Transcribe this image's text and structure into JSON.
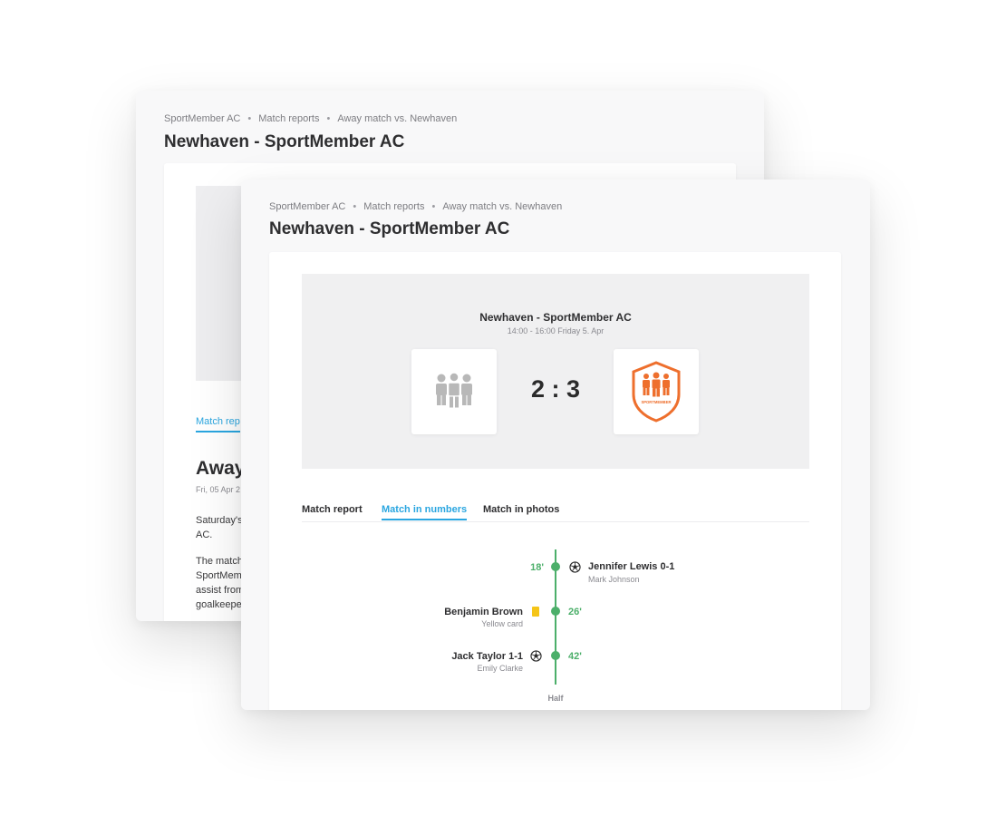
{
  "breadcrumb": [
    "SportMember AC",
    "Match reports",
    "Away match vs. Newhaven"
  ],
  "page_title": "Newhaven - SportMember AC",
  "back_card": {
    "tab_partial": "Match rep",
    "heading_partial": "Away",
    "date_partial": "Fri, 05 Apr 2",
    "para1_lines": [
      "Saturday's",
      "AC."
    ],
    "para2_lines": [
      "The match",
      "SportMem",
      "assist from",
      "goalkeepe"
    ]
  },
  "scoreboard": {
    "match_title": "Newhaven - SportMember AC",
    "time": "14:00 - 16:00 Friday 5. Apr",
    "score": "2 : 3",
    "home_icon": "team-group-icon",
    "away_icon": "sportmember-shield-logo",
    "away_logo_text": "SPORTMEMBER",
    "home_color": "#b8b8b8",
    "away_color": "#ee6f2d"
  },
  "tabs": [
    {
      "label": "Match report",
      "active": false
    },
    {
      "label": "Match in numbers",
      "active": true
    },
    {
      "label": "Match in photos",
      "active": false
    }
  ],
  "events": [
    {
      "minute": "18'",
      "side": "away",
      "type": "goal",
      "name": "Jennifer Lewis 0-1",
      "detail": "Mark Johnson"
    },
    {
      "minute": "26'",
      "side": "home",
      "type": "yellow-card",
      "name": "Benjamin Brown",
      "detail": "Yellow card"
    },
    {
      "minute": "42'",
      "side": "home",
      "type": "goal",
      "name": "Jack Taylor 1-1",
      "detail": "Emily Clarke"
    }
  ],
  "half_label": "Half",
  "colors": {
    "accent": "#2aa6e0",
    "timeline": "#4caf6a",
    "yellow_card": "#f5c518",
    "brand_orange": "#ee6f2d"
  }
}
